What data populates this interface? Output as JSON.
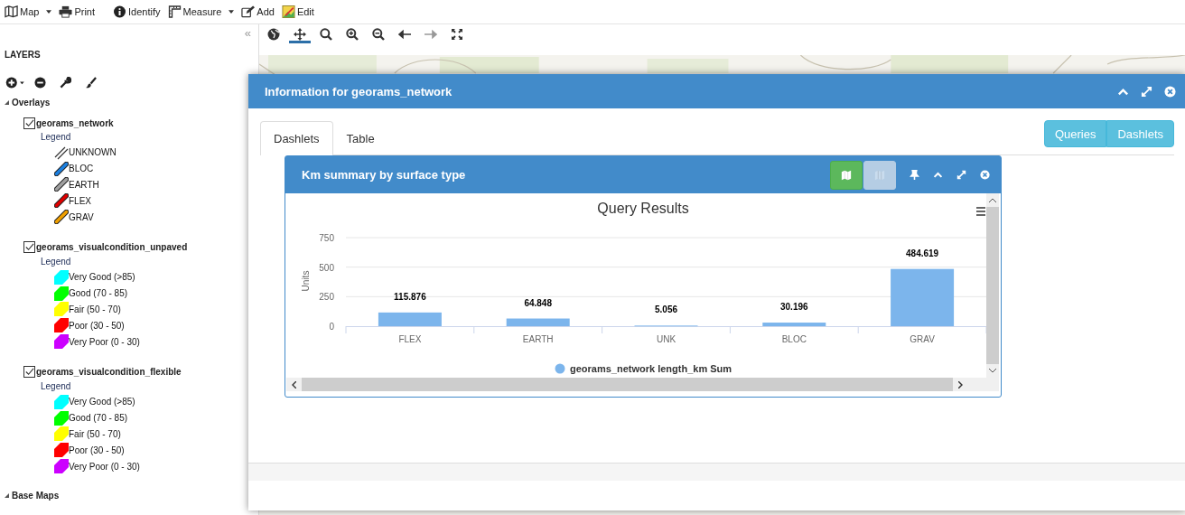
{
  "toolbar": [
    {
      "label": "Map",
      "has_menu": true
    },
    {
      "label": "Print",
      "has_menu": false
    },
    {
      "label": "Identify",
      "has_menu": false
    },
    {
      "label": "Measure",
      "has_menu": true
    },
    {
      "label": "Add",
      "has_menu": false
    },
    {
      "label": "Edit",
      "has_menu": false
    }
  ],
  "collapse": "«",
  "sidebar": {
    "title": "LAYERS",
    "groups": [
      {
        "label": "Overlays",
        "expanded": true,
        "layers": [
          {
            "name": "georams_network",
            "checked": true,
            "legend_title": "Legend",
            "legend": [
              {
                "label": "UNKNOWN",
                "kind": "hatch"
              },
              {
                "label": "BLOC",
                "kind": "line",
                "color": "#1a7fe0"
              },
              {
                "label": "EARTH",
                "kind": "line",
                "color": "#a0a0a0"
              },
              {
                "label": "FLEX",
                "kind": "line",
                "color": "#e00000"
              },
              {
                "label": "GRAV",
                "kind": "line",
                "color": "#f0a000"
              }
            ]
          },
          {
            "name": "georams_visualcondition_unpaved",
            "checked": true,
            "legend_title": "Legend",
            "legend": [
              {
                "label": "Very Good (>85)",
                "kind": "block",
                "color": "#00ffff"
              },
              {
                "label": "Good (70 - 85)",
                "kind": "block",
                "color": "#00ff00"
              },
              {
                "label": "Fair (50 - 70)",
                "kind": "block",
                "color": "#ffff00"
              },
              {
                "label": "Poor (30 - 50)",
                "kind": "block",
                "color": "#ff0000"
              },
              {
                "label": "Very Poor (0 - 30)",
                "kind": "block",
                "color": "#cc00ff"
              }
            ]
          },
          {
            "name": "georams_visualcondition_flexible",
            "checked": true,
            "legend_title": "Legend",
            "legend": [
              {
                "label": "Very Good (>85)",
                "kind": "block",
                "color": "#00ffff"
              },
              {
                "label": "Good (70 - 85)",
                "kind": "block",
                "color": "#00ff00"
              },
              {
                "label": "Fair (50 - 70)",
                "kind": "block",
                "color": "#ffff00"
              },
              {
                "label": "Poor (30 - 50)",
                "kind": "block",
                "color": "#ff0000"
              },
              {
                "label": "Very Poor (0 - 30)",
                "kind": "block",
                "color": "#cc00ff"
              }
            ]
          }
        ]
      },
      {
        "label": "Base Maps",
        "expanded": true
      }
    ]
  },
  "map_tools": [
    {
      "selected": false,
      "disabled": false
    },
    {
      "selected": true,
      "disabled": false
    },
    {
      "selected": false,
      "disabled": false
    },
    {
      "selected": false,
      "disabled": false
    },
    {
      "selected": false,
      "disabled": false
    },
    {
      "selected": false,
      "disabled": false
    },
    {
      "selected": false,
      "disabled": true
    },
    {
      "selected": false,
      "disabled": false
    }
  ],
  "dialog": {
    "title": "Information for georams_network",
    "tabs": [
      {
        "label": "Dashlets",
        "selected": true
      },
      {
        "label": "Table",
        "selected": false
      }
    ],
    "buttons": [
      "Queries",
      "Dashlets"
    ],
    "dashlet": {
      "title": "Km summary by surface type",
      "map_toggles": [
        {
          "selected": true
        },
        {
          "selected": false
        }
      ],
      "chart_data": {
        "type": "bar",
        "title": "Query Results",
        "ylabel": "Units",
        "categories": [
          "FLEX",
          "EARTH",
          "UNK",
          "BLOC",
          "GRAV"
        ],
        "series": [
          {
            "name": "georams_network length_km Sum",
            "color": "#7cb5ec",
            "values": [
              115.876,
              64.848,
              5.056,
              30.196,
              484.619
            ]
          }
        ],
        "ylim": [
          0,
          750
        ],
        "yticks": [
          0,
          250,
          500,
          750
        ],
        "data_labels": true
      }
    }
  }
}
